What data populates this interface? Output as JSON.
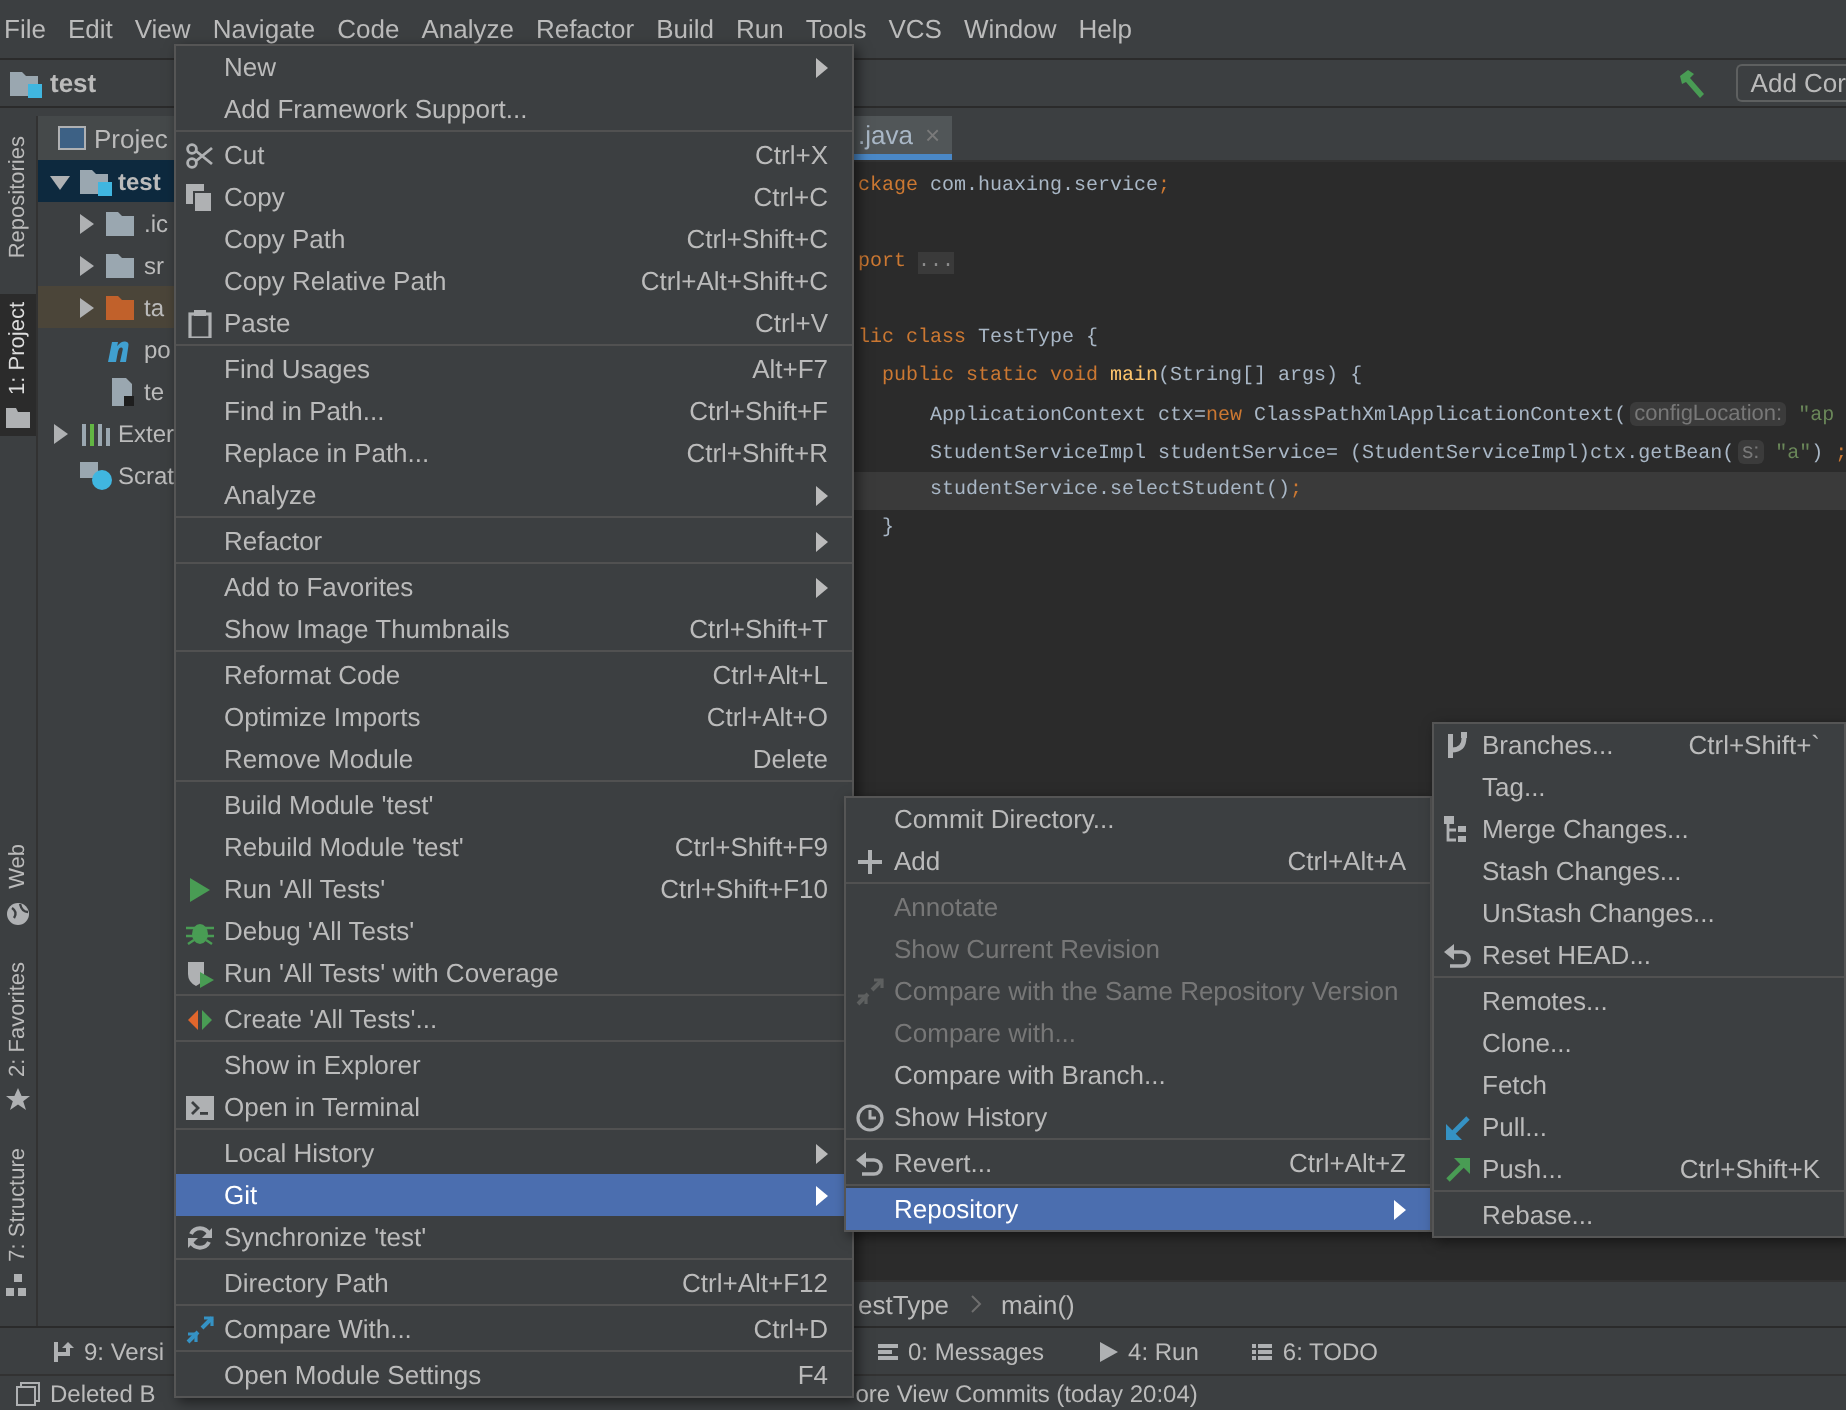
{
  "menubar": [
    "File",
    "Edit",
    "View",
    "Navigate",
    "Code",
    "Analyze",
    "Refactor",
    "Build",
    "Run",
    "Tools",
    "VCS",
    "Window",
    "Help"
  ],
  "toolbar": {
    "project": "test",
    "run_config_button": "Add Cor"
  },
  "left_strip": {
    "top": [
      {
        "label": "Repositories",
        "selected": false
      },
      {
        "label": "1: Project",
        "selected": true
      }
    ],
    "bottom": [
      {
        "label": "Web",
        "selected": false
      },
      {
        "label": "2: Favorites",
        "selected": false
      },
      {
        "label": "7: Structure",
        "selected": false
      }
    ]
  },
  "project_panel": {
    "title": "Projec",
    "tree": [
      {
        "label": "test",
        "kind": "module",
        "expanded": true,
        "selected": true,
        "children": [
          {
            "label": ".ic",
            "kind": "folder",
            "expanded": false,
            "selected": false
          },
          {
            "label": "sr",
            "kind": "folder",
            "expanded": false,
            "selected": false
          },
          {
            "label": "ta",
            "kind": "excluded",
            "expanded": false,
            "selected": false
          },
          {
            "label": "po",
            "kind": "maven",
            "selected": false
          },
          {
            "label": "te",
            "kind": "file",
            "selected": false
          }
        ]
      },
      {
        "label": "Exter",
        "kind": "library",
        "expanded": false,
        "selected": false
      },
      {
        "label": "Scrat",
        "kind": "scratch",
        "selected": false
      }
    ]
  },
  "editor": {
    "tab": {
      "label": ".java",
      "close": "×"
    },
    "lines": [
      {
        "blank_before": false,
        "current": false,
        "tokens": [
          {
            "kind": "keyword",
            "text": "ckage"
          },
          {
            "kind": "plain",
            "text": " com.huaxing.service"
          },
          {
            "kind": "keyword",
            "text": ";"
          }
        ]
      },
      {
        "blank_before": true,
        "current": false,
        "tokens": [
          {
            "kind": "keyword",
            "text": "port "
          },
          {
            "kind": "fold",
            "text": "..."
          }
        ]
      },
      {
        "blank_before": true,
        "current": false,
        "tokens": [
          {
            "kind": "keyword",
            "text": "lic class"
          },
          {
            "kind": "plain",
            "text": " TestType {"
          }
        ]
      },
      {
        "blank_before": false,
        "current": false,
        "tokens": [
          {
            "kind": "keyword",
            "text": "  public static void "
          },
          {
            "kind": "method",
            "text": "main"
          },
          {
            "kind": "plain",
            "text": "(String[] args) {"
          }
        ]
      },
      {
        "blank_before": false,
        "current": false,
        "tokens": [
          {
            "kind": "plain",
            "text": "      ApplicationContext ctx="
          },
          {
            "kind": "keyword",
            "text": "new"
          },
          {
            "kind": "plain",
            "text": " ClassPathXmlApplicationContext("
          },
          {
            "kind": "hint",
            "text": "configLocation:"
          },
          {
            "kind": "string",
            "text": " \"ap"
          }
        ]
      },
      {
        "blank_before": false,
        "current": false,
        "tokens": [
          {
            "kind": "plain",
            "text": "      StudentServiceImpl studentService= (StudentServiceImpl)ctx.getBean("
          },
          {
            "kind": "hint",
            "text": "s:"
          },
          {
            "kind": "string",
            "text": " \"a\""
          },
          {
            "kind": "plain",
            "text": ") "
          },
          {
            "kind": "keyword",
            "text": ";"
          }
        ]
      },
      {
        "blank_before": false,
        "current": true,
        "tokens": [
          {
            "kind": "plain",
            "text": "      studentService.selectStudent()"
          },
          {
            "kind": "keyword",
            "text": ";"
          }
        ]
      },
      {
        "blank_before": false,
        "current": false,
        "tokens": [
          {
            "kind": "plain",
            "text": "  }"
          }
        ]
      }
    ],
    "breadcrumb": [
      "estType",
      "main()"
    ]
  },
  "context_menus": [
    {
      "groups": [
        [
          {
            "label": "New",
            "submenu": true,
            "selected": false,
            "disabled": false
          },
          {
            "label": "Add Framework Support...",
            "submenu": false,
            "selected": false,
            "disabled": false
          }
        ],
        [
          {
            "label": "Cut",
            "shortcut": "Ctrl+X",
            "kind": "cut",
            "submenu": false,
            "selected": false,
            "disabled": false
          },
          {
            "label": "Copy",
            "shortcut": "Ctrl+C",
            "kind": "copy",
            "submenu": false,
            "selected": false,
            "disabled": false
          },
          {
            "label": "Copy Path",
            "shortcut": "Ctrl+Shift+C",
            "submenu": false,
            "selected": false,
            "disabled": false
          },
          {
            "label": "Copy Relative Path",
            "shortcut": "Ctrl+Alt+Shift+C",
            "submenu": false,
            "selected": false,
            "disabled": false
          },
          {
            "label": "Paste",
            "shortcut": "Ctrl+V",
            "kind": "paste",
            "submenu": false,
            "selected": false,
            "disabled": false
          }
        ],
        [
          {
            "label": "Find Usages",
            "shortcut": "Alt+F7",
            "submenu": false,
            "selected": false,
            "disabled": false
          },
          {
            "label": "Find in Path...",
            "shortcut": "Ctrl+Shift+F",
            "submenu": false,
            "selected": false,
            "disabled": false
          },
          {
            "label": "Replace in Path...",
            "shortcut": "Ctrl+Shift+R",
            "submenu": false,
            "selected": false,
            "disabled": false
          },
          {
            "label": "Analyze",
            "submenu": true,
            "selected": false,
            "disabled": false
          }
        ],
        [
          {
            "label": "Refactor",
            "submenu": true,
            "selected": false,
            "disabled": false
          }
        ],
        [
          {
            "label": "Add to Favorites",
            "submenu": true,
            "selected": false,
            "disabled": false
          },
          {
            "label": "Show Image Thumbnails",
            "shortcut": "Ctrl+Shift+T",
            "submenu": false,
            "selected": false,
            "disabled": false
          }
        ],
        [
          {
            "label": "Reformat Code",
            "shortcut": "Ctrl+Alt+L",
            "submenu": false,
            "selected": false,
            "disabled": false
          },
          {
            "label": "Optimize Imports",
            "shortcut": "Ctrl+Alt+O",
            "submenu": false,
            "selected": false,
            "disabled": false
          },
          {
            "label": "Remove Module",
            "shortcut": "Delete",
            "submenu": false,
            "selected": false,
            "disabled": false
          }
        ],
        [
          {
            "label": "Build Module 'test'",
            "submenu": false,
            "selected": false,
            "disabled": false
          },
          {
            "label": "Rebuild Module 'test'",
            "shortcut": "Ctrl+Shift+F9",
            "submenu": false,
            "selected": false,
            "disabled": false
          },
          {
            "label": "Run 'All Tests'",
            "shortcut": "Ctrl+Shift+F10",
            "kind": "run",
            "submenu": false,
            "selected": false,
            "disabled": false
          },
          {
            "label": "Debug 'All Tests'",
            "kind": "debug",
            "submenu": false,
            "selected": false,
            "disabled": false
          },
          {
            "label": "Run 'All Tests' with Coverage",
            "kind": "coverage",
            "submenu": false,
            "selected": false,
            "disabled": false
          }
        ],
        [
          {
            "label": "Create 'All Tests'...",
            "kind": "create",
            "submenu": false,
            "selected": false,
            "disabled": false
          }
        ],
        [
          {
            "label": "Show in Explorer",
            "submenu": false,
            "selected": false,
            "disabled": false
          },
          {
            "label": "Open in Terminal",
            "kind": "terminal",
            "submenu": false,
            "selected": false,
            "disabled": false
          }
        ],
        [
          {
            "label": "Local History",
            "submenu": true,
            "selected": false,
            "disabled": false
          },
          {
            "label": "Git",
            "submenu": true,
            "selected": true,
            "disabled": false
          },
          {
            "label": "Synchronize 'test'",
            "kind": "sync",
            "submenu": false,
            "selected": false,
            "disabled": false
          }
        ],
        [
          {
            "label": "Directory Path",
            "shortcut": "Ctrl+Alt+F12",
            "submenu": false,
            "selected": false,
            "disabled": false
          }
        ],
        [
          {
            "label": "Compare With...",
            "shortcut": "Ctrl+D",
            "kind": "compare",
            "submenu": false,
            "selected": false,
            "disabled": false
          }
        ],
        [
          {
            "label": "Open Module Settings",
            "shortcut": "F4",
            "submenu": false,
            "selected": false,
            "disabled": false
          }
        ]
      ]
    },
    {
      "groups": [
        [
          {
            "label": "Commit Directory...",
            "submenu": false,
            "selected": false,
            "disabled": false
          },
          {
            "label": "Add",
            "shortcut": "Ctrl+Alt+A",
            "kind": "plus",
            "submenu": false,
            "selected": false,
            "disabled": false
          }
        ],
        [
          {
            "label": "Annotate",
            "submenu": false,
            "selected": false,
            "disabled": true
          },
          {
            "label": "Show Current Revision",
            "submenu": false,
            "selected": false,
            "disabled": true
          },
          {
            "label": "Compare with the Same Repository Version",
            "kind": "compare",
            "submenu": false,
            "selected": false,
            "disabled": true
          },
          {
            "label": "Compare with...",
            "submenu": false,
            "selected": false,
            "disabled": true
          },
          {
            "label": "Compare with Branch...",
            "submenu": false,
            "selected": false,
            "disabled": false
          },
          {
            "label": "Show History",
            "kind": "clock",
            "submenu": false,
            "selected": false,
            "disabled": false
          }
        ],
        [
          {
            "label": "Revert...",
            "shortcut": "Ctrl+Alt+Z",
            "kind": "revert",
            "submenu": false,
            "selected": false,
            "disabled": false
          }
        ],
        [
          {
            "label": "Repository",
            "submenu": true,
            "selected": true,
            "disabled": false
          }
        ]
      ]
    },
    {
      "groups": [
        [
          {
            "label": "Branches...",
            "shortcut": "Ctrl+Shift+`",
            "kind": "branch",
            "submenu": false,
            "selected": false,
            "disabled": false
          },
          {
            "label": "Tag...",
            "submenu": false,
            "selected": false,
            "disabled": false
          },
          {
            "label": "Merge Changes...",
            "kind": "merge",
            "submenu": false,
            "selected": false,
            "disabled": false
          },
          {
            "label": "Stash Changes...",
            "submenu": false,
            "selected": false,
            "disabled": false
          },
          {
            "label": "UnStash Changes...",
            "submenu": false,
            "selected": false,
            "disabled": false
          },
          {
            "label": "Reset HEAD...",
            "kind": "revert",
            "submenu": false,
            "selected": false,
            "disabled": false
          }
        ],
        [
          {
            "label": "Remotes...",
            "submenu": false,
            "selected": false,
            "disabled": false
          },
          {
            "label": "Clone...",
            "submenu": false,
            "selected": false,
            "disabled": false
          },
          {
            "label": "Fetch",
            "submenu": false,
            "selected": false,
            "disabled": false
          },
          {
            "label": "Pull...",
            "kind": "pull",
            "submenu": false,
            "selected": false,
            "disabled": false
          },
          {
            "label": "Push...",
            "shortcut": "Ctrl+Shift+K",
            "kind": "push",
            "submenu": false,
            "selected": false,
            "disabled": false
          }
        ],
        [
          {
            "label": "Rebase...",
            "submenu": false,
            "selected": false,
            "disabled": false
          }
        ]
      ]
    }
  ],
  "tool_window_bar": [
    "9: Versi",
    "0: Messages",
    "4: Run",
    "6: TODO"
  ],
  "status_bar": [
    "Deleted B",
    "ore View Commits (today 20:04)"
  ]
}
